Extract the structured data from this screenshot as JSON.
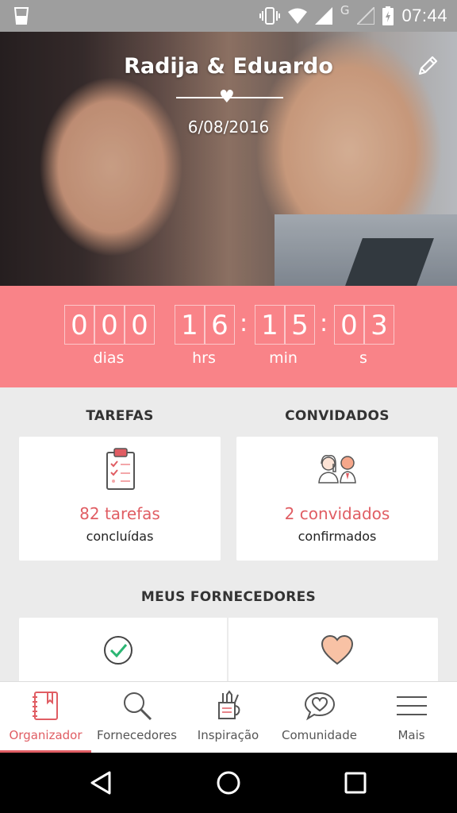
{
  "status_bar": {
    "time": "07:44",
    "network_letter": "G",
    "icons": [
      "app-notification-icon",
      "vibrate-icon",
      "wifi-icon",
      "signal-icon",
      "signal-empty-icon",
      "battery-charging-icon"
    ]
  },
  "hero": {
    "couple_names": "Radija & Eduardo",
    "wedding_date": "6/08/2016",
    "edit_icon": "pencil-icon"
  },
  "countdown": {
    "days": [
      "0",
      "0",
      "0"
    ],
    "hours": [
      "1",
      "6"
    ],
    "minutes": [
      "1",
      "5"
    ],
    "seconds": [
      "0",
      "3"
    ],
    "separator": ":",
    "labels": {
      "days": "dias",
      "hours": "hrs",
      "minutes": "min",
      "seconds": "s"
    }
  },
  "tasks": {
    "title": "TAREFAS",
    "value": "82 tarefas",
    "label": "concluídas",
    "icon": "clipboard-checklist-icon"
  },
  "guests": {
    "title": "CONVIDADOS",
    "value": "2 convidados",
    "label": "confirmados",
    "icon": "couple-avatars-icon"
  },
  "vendors": {
    "title": "MEUS FORNECEDORES",
    "icons": [
      "checkmark-circle-icon",
      "heart-icon"
    ]
  },
  "tabs": [
    {
      "label": "Organizador",
      "icon": "notebook-icon",
      "active": true
    },
    {
      "label": "Fornecedores",
      "icon": "magnifier-icon",
      "active": false
    },
    {
      "label": "Inspiração",
      "icon": "pencil-cup-icon",
      "active": false
    },
    {
      "label": "Comunidade",
      "icon": "heart-speech-bubble-icon",
      "active": false
    },
    {
      "label": "Mais",
      "icon": "hamburger-menu-icon",
      "active": false
    }
  ],
  "colors": {
    "accent": "#e05d63",
    "countdown_bg": "#f98388",
    "page_bg": "#ebebeb"
  }
}
